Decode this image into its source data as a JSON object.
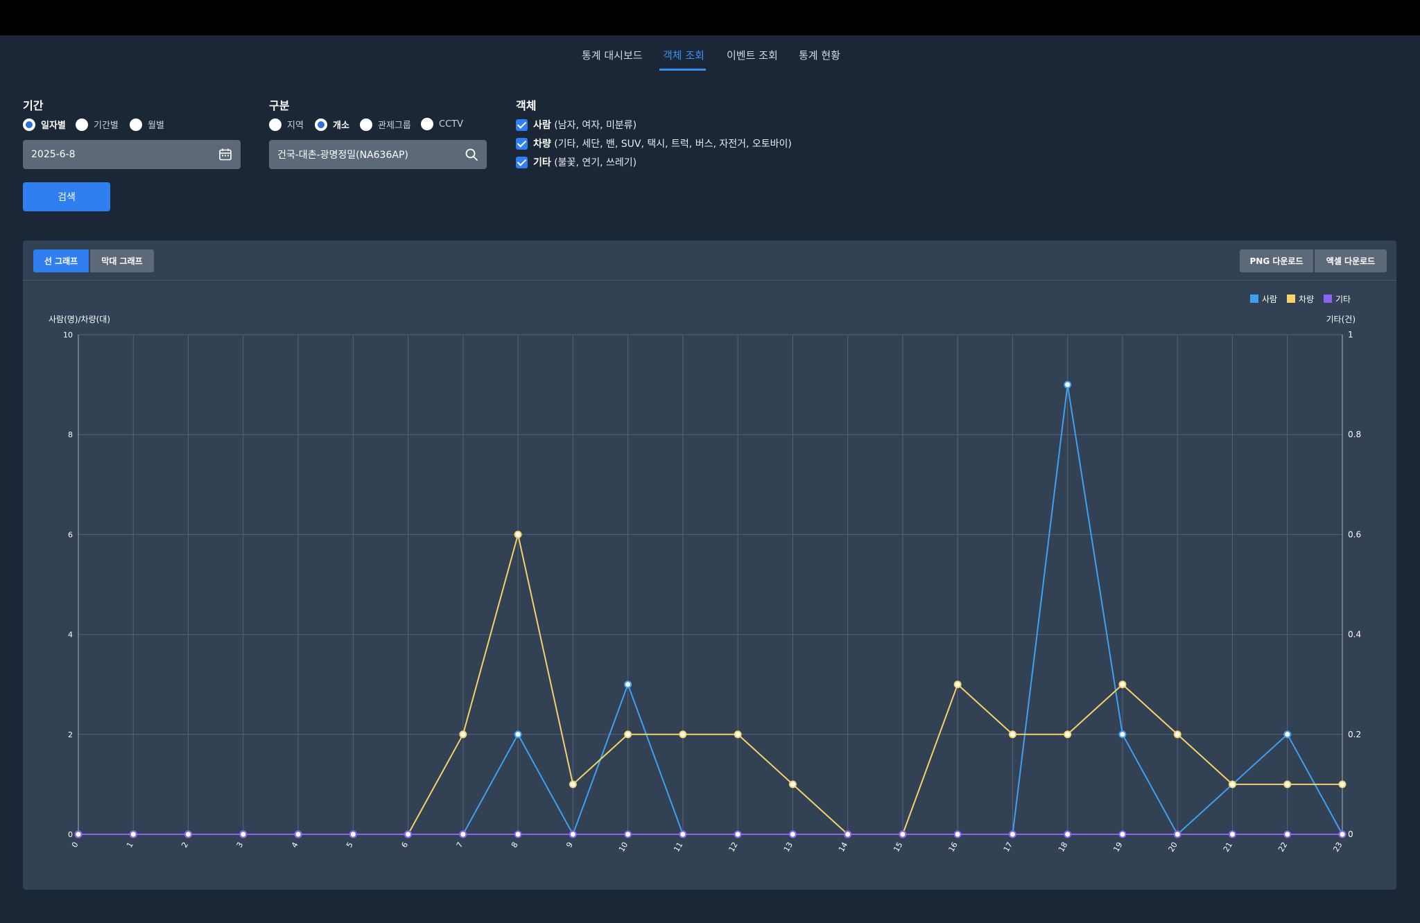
{
  "nav": {
    "tabs": [
      {
        "label": "통계 대시보드"
      },
      {
        "label": "객체 조회",
        "active": true
      },
      {
        "label": "이벤트 조회"
      },
      {
        "label": "통계 현황"
      }
    ],
    "accent_color": "#3b8ff0"
  },
  "period": {
    "title": "기간",
    "options": [
      "일자별",
      "기간별",
      "월별"
    ],
    "selected": "일자별",
    "date_value": "2025-6-8",
    "calendar_icon": "calendar-icon"
  },
  "division": {
    "title": "구분",
    "options": [
      "지역",
      "개소",
      "관제그룹",
      "CCTV"
    ],
    "selected": "개소",
    "location_value": "건국-대촌-광명정밀(NA636AP)",
    "search_icon": "search-icon"
  },
  "objects": {
    "title": "객체",
    "items": [
      {
        "bold": "사람",
        "detail": " (남자, 여자, 미분류)",
        "checked": true
      },
      {
        "bold": "차량",
        "detail": " (기타, 세단, 밴, SUV, 택시, 트럭, 버스, 자전거, 오토바이)",
        "checked": true
      },
      {
        "bold": "기타",
        "detail": " (불꽃, 연기, 쓰레기)",
        "checked": true
      }
    ]
  },
  "search_button": "검색",
  "chart_panel": {
    "view_buttons": [
      "선 그래프",
      "막대 그래프"
    ],
    "active_view": "선 그래프",
    "download_buttons": [
      "PNG 다운로드",
      "엑셀 다운로드"
    ]
  },
  "chart_data": {
    "type": "line",
    "x": [
      "0",
      "1",
      "2",
      "3",
      "4",
      "5",
      "6",
      "7",
      "8",
      "9",
      "10",
      "11",
      "12",
      "13",
      "14",
      "15",
      "16",
      "17",
      "18",
      "19",
      "20",
      "21",
      "22",
      "23"
    ],
    "ylabel": "사람(명)/차량(대)",
    "y2label": "기타(건)",
    "ylim": [
      0,
      10
    ],
    "y2lim": [
      0,
      1
    ],
    "yticks": [
      "0",
      "2",
      "4",
      "6",
      "8",
      "10"
    ],
    "y2ticks": [
      "0",
      "0.2",
      "0.4",
      "0.6",
      "0.8",
      "1"
    ],
    "grid": true,
    "legend_position": "top-right",
    "series": [
      {
        "name": "사람",
        "color": "#3ea1f0",
        "axis": "left",
        "values": [
          0,
          0,
          0,
          0,
          0,
          0,
          0,
          0,
          2,
          0,
          3,
          0,
          0,
          0,
          0,
          0,
          0,
          0,
          9,
          2,
          0,
          1,
          2,
          0
        ]
      },
      {
        "name": "차량",
        "color": "#f5d36b",
        "axis": "left",
        "values": [
          0,
          0,
          0,
          0,
          0,
          0,
          0,
          2,
          6,
          1,
          2,
          2,
          2,
          1,
          0,
          0,
          3,
          2,
          2,
          3,
          2,
          1,
          1,
          1
        ]
      },
      {
        "name": "기타",
        "color": "#8a64f0",
        "axis": "right",
        "values": [
          0,
          0,
          0,
          0,
          0,
          0,
          0,
          0,
          0,
          0,
          0,
          0,
          0,
          0,
          0,
          0,
          0,
          0,
          0,
          0,
          0,
          0,
          0,
          0
        ]
      }
    ]
  }
}
